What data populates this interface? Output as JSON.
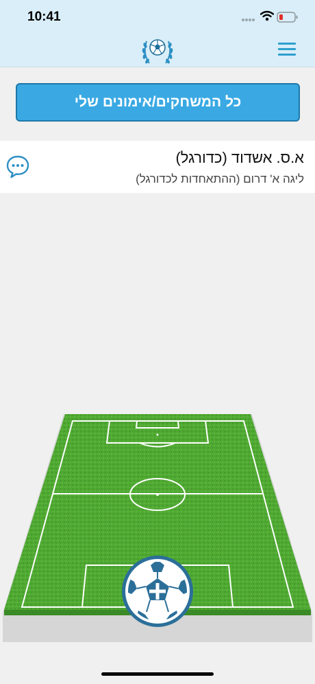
{
  "status_bar": {
    "time": "10:41"
  },
  "header": {
    "logo_icon": "soccer-ball-laurel-logo",
    "menu_icon": "hamburger-menu-icon"
  },
  "main": {
    "all_games_button_label": "כל המשחקים/אימונים שלי",
    "team": {
      "name": "א.ס. אשדוד (כדורגל)",
      "league": "ליגה א' דרום (ההתאחדות לכדורגל)",
      "chat_icon": "chat-bubble-icon"
    },
    "field_icon": "soccer-field",
    "add_button_icon": "soccer-ball-plus-icon"
  },
  "colors": {
    "header_bg": "#d9eef8",
    "accent": "#3aa9e3",
    "accent_border": "#1e78a8",
    "field_green": "#4fa832",
    "battery_low": "#e0302a"
  }
}
